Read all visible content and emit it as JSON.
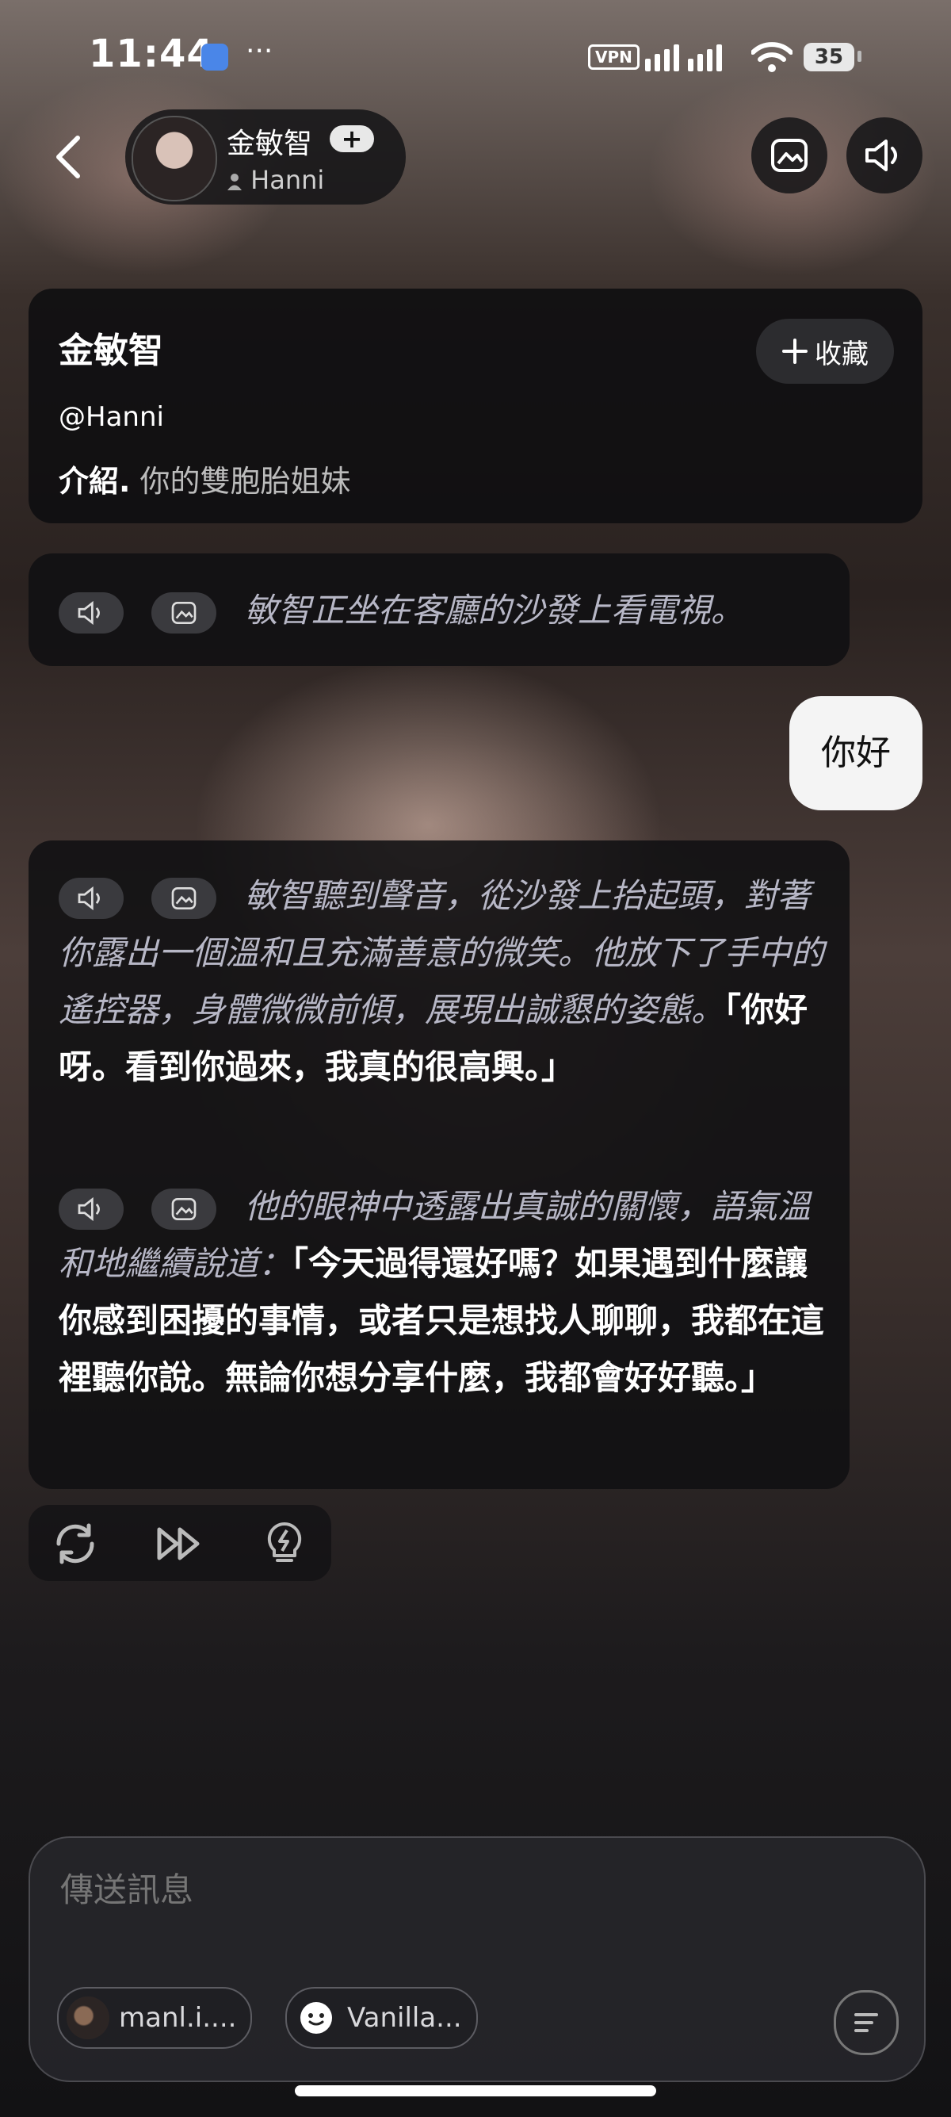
{
  "status_bar": {
    "time": "11:44",
    "dots": "···",
    "vpn": "VPN",
    "battery": "35"
  },
  "header": {
    "name": "金敏智",
    "plus": "+",
    "username": "Hanni",
    "icons": [
      "back-chevron-icon",
      "image-icon",
      "speaker-icon"
    ]
  },
  "info_card": {
    "title": "金敏智",
    "favorite_label": "收藏",
    "handle": "@Hanni",
    "intro_label": "介紹.",
    "intro_text": "你的雙胞胎姐妹"
  },
  "messages": {
    "scene": "敏智正坐在客廳的沙發上看電視。",
    "user": "你好",
    "reply_1_narration": "敏智聽到聲音，從沙發上抬起頭，對著你露出一個溫和且充滿善意的微笑。他放下了手中的遙控器，身體微微前傾，展現出誠懇的姿態。",
    "reply_1_speech": "「你好呀。看到你過來，我真的很高興。」",
    "reply_2_narration": "他的眼神中透露出真誠的關懷，語氣溫和地繼續說道：",
    "reply_2_speech": "「今天過得還好嗎？如果遇到什麼讓你感到困擾的事情，或者只是想找人聊聊，我都在這裡聽你說。無論你想分享什麼，我都會好好聽。」"
  },
  "composer": {
    "placeholder": "傳送訊息",
    "chips": [
      {
        "label": "manl.i...."
      },
      {
        "label": "Vanilla..."
      }
    ]
  },
  "colors": {
    "accent_bubble": "#f4f4f4",
    "card_bg": "#0e0e10",
    "narration": "#b7b7c6"
  }
}
